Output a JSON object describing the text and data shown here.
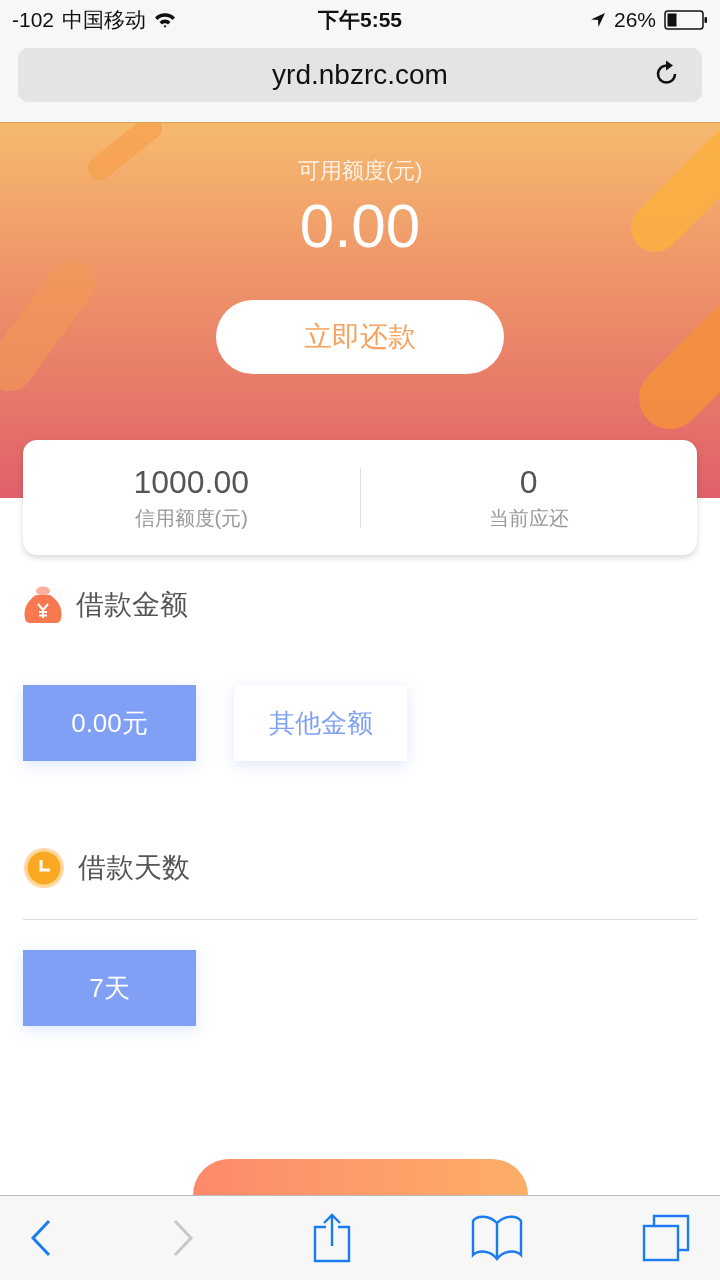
{
  "status_bar": {
    "signal": "-102",
    "carrier": "中国移动",
    "time": "下午5:55",
    "battery": "26%"
  },
  "browser": {
    "url": "yrd.nbzrc.com"
  },
  "hero": {
    "label": "可用额度(元)",
    "amount": "0.00",
    "button": "立即还款"
  },
  "summary": [
    {
      "value": "1000.00",
      "label": "信用额度(元)"
    },
    {
      "value": "0",
      "label": "当前应还"
    }
  ],
  "amount_section": {
    "title": "借款金额",
    "options": [
      {
        "label": "0.00元",
        "selected": true
      },
      {
        "label": "其他金额",
        "selected": false
      }
    ]
  },
  "days_section": {
    "title": "借款天数",
    "options": [
      {
        "label": "7天",
        "selected": true
      }
    ]
  },
  "submit": {
    "kind": "gradient-button"
  },
  "toolbar": [
    {
      "kind": "back",
      "disabled": false
    },
    {
      "kind": "forward",
      "disabled": true
    },
    {
      "kind": "share",
      "disabled": false
    },
    {
      "kind": "bookmarks",
      "disabled": false
    },
    {
      "kind": "tabs",
      "disabled": false
    }
  ]
}
